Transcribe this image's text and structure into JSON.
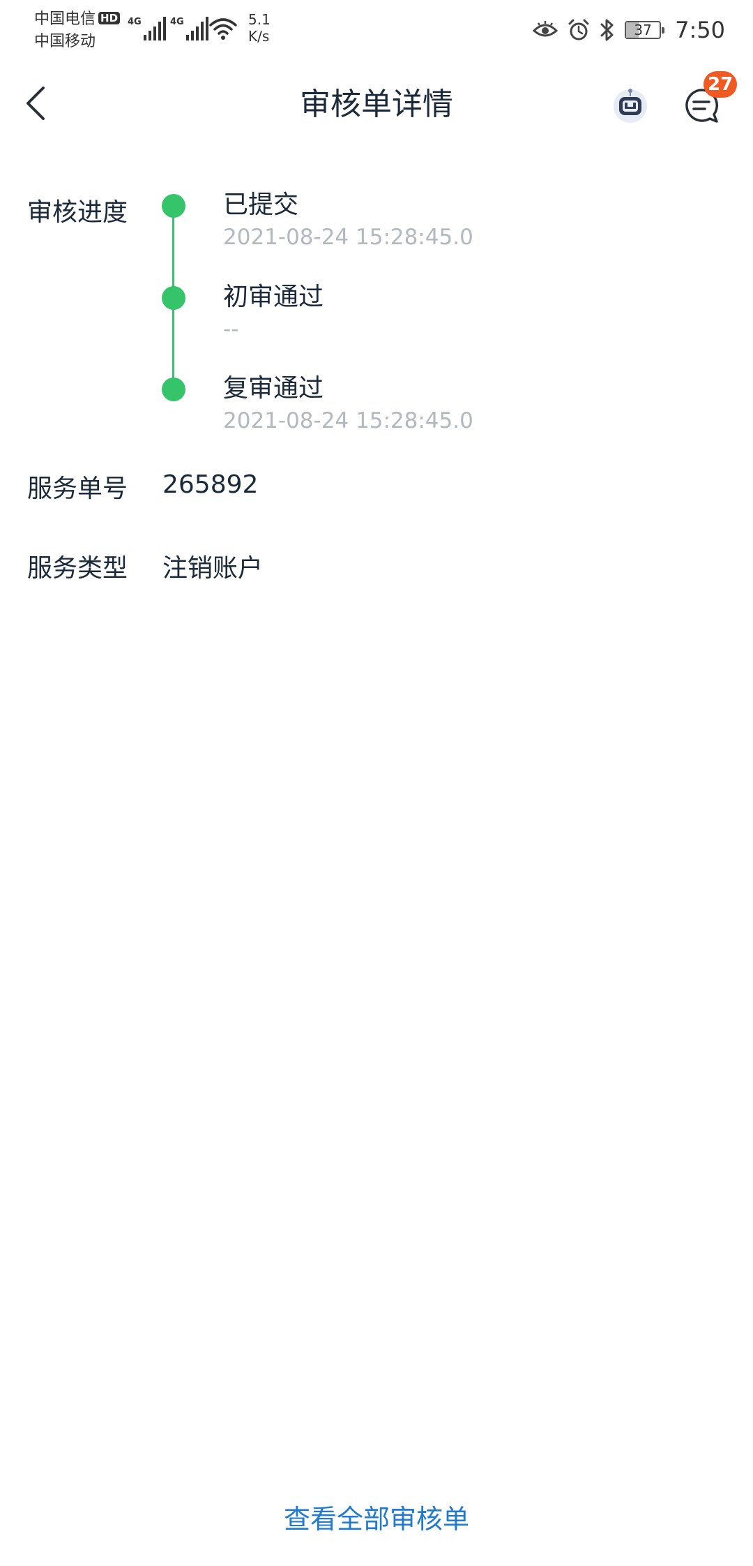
{
  "status_bar": {
    "carrier_1": "中国电信",
    "hd_label": "HD",
    "carrier_2": "中国移动",
    "network_1": "4G",
    "network_2": "4G",
    "net_speed_value": "5.1",
    "net_speed_unit": "K/s",
    "battery_percent": "37",
    "battery_level": 0.37,
    "time": "7:50"
  },
  "header": {
    "title": "审核单详情",
    "message_badge_count": "27",
    "badge_color": "#f05a22"
  },
  "progress": {
    "label": "审核进度",
    "accent_color": "#35c46a",
    "steps": [
      {
        "title": "已提交",
        "time": "2021-08-24 15:28:45.0"
      },
      {
        "title": "初审通过",
        "time": "--"
      },
      {
        "title": "复审通过",
        "time": "2021-08-24 15:28:45.0"
      }
    ]
  },
  "service_number": {
    "label": "服务单号",
    "value": "265892"
  },
  "service_type": {
    "label": "服务类型",
    "value": "注销账户"
  },
  "footer": {
    "view_all_label": "查看全部审核单",
    "link_color": "#1f7ad0"
  },
  "icons": {
    "back": "chevron-left-icon",
    "robot": "robot-assistant-icon",
    "message": "chat-bubble-icon",
    "eye": "eye-comfort-icon",
    "alarm": "alarm-clock-icon",
    "bluetooth": "bluetooth-icon",
    "wifi": "wifi-icon"
  }
}
